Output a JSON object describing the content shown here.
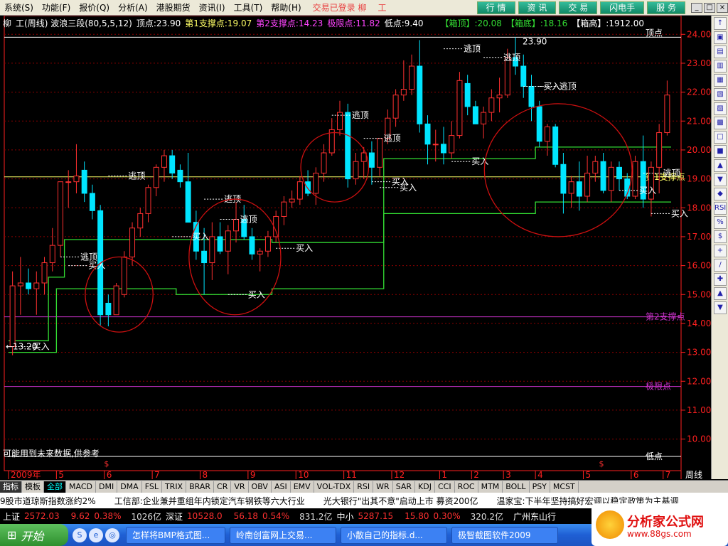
{
  "menu": [
    "系统(S)",
    "功能(F)",
    "报价(Q)",
    "分析(A)",
    "港股期货",
    "资讯(I)",
    "工具(T)",
    "帮助(H)"
  ],
  "status_text": "交易已登录 柳",
  "stock_code": "工",
  "nav_buttons": [
    "行 情",
    "资 讯",
    "交 易",
    "闪电手",
    "服 务"
  ],
  "window_controls": [
    "_",
    "□",
    "×"
  ],
  "info": {
    "prefix": "柳",
    "title": "工(周线) 波浪三段(80,5,5,12)",
    "top_point": "顶点:23.90",
    "support1": "第1支撑点:19.07",
    "support2": "第2支撑点:14.23",
    "limit_point": "极限点:11.82",
    "low_point": "低点:9.40",
    "box_top": "【箱顶】:20.08",
    "box_bottom": "【箱底】:18.16",
    "box_height": "【箱高】:1912.00"
  },
  "chart_data": {
    "type": "candlestick",
    "ylim": [
      9.4,
      24.4
    ],
    "y_ticks": [
      10,
      11,
      12,
      13,
      14,
      15,
      16,
      17,
      18,
      19,
      20,
      21,
      22,
      23,
      24
    ],
    "y_tick_labels": [
      "10.00",
      "11.00",
      "12.00",
      "13.00",
      "14.00",
      "15.00",
      "16.00",
      "17.00",
      "18.00",
      "19.00",
      "20.00",
      "21.00",
      "22.00",
      "23.00",
      "24.00"
    ],
    "x_labels": [
      "2009年",
      "5",
      "6",
      "7",
      "8",
      "9",
      "10",
      "11",
      "12",
      "1",
      "2",
      "3",
      "4",
      "5",
      "6",
      "7",
      "周线"
    ],
    "candles": [
      {
        "o": 13.2,
        "h": 15.8,
        "l": 12.9,
        "c": 15.3
      },
      {
        "o": 15.3,
        "h": 16.3,
        "l": 14.3,
        "c": 15.4
      },
      {
        "o": 15.4,
        "h": 15.9,
        "l": 15.0,
        "c": 15.2
      },
      {
        "o": 15.2,
        "h": 15.8,
        "l": 14.3,
        "c": 15.4
      },
      {
        "o": 15.4,
        "h": 16.3,
        "l": 15.0,
        "c": 16.1
      },
      {
        "o": 16.1,
        "h": 17.3,
        "l": 15.8,
        "c": 16.7
      },
      {
        "o": 16.7,
        "h": 18.0,
        "l": 16.3,
        "c": 18.9
      },
      {
        "o": 18.9,
        "h": 19.3,
        "l": 18.0,
        "c": 18.9
      },
      {
        "o": 18.9,
        "h": 20.2,
        "l": 18.5,
        "c": 19.1
      },
      {
        "o": 19.3,
        "h": 19.6,
        "l": 18.2,
        "c": 18.5
      },
      {
        "o": 18.5,
        "h": 18.8,
        "l": 17.6,
        "c": 17.9
      },
      {
        "o": 17.9,
        "h": 18.1,
        "l": 13.9,
        "c": 14.3
      },
      {
        "o": 14.7,
        "h": 15.0,
        "l": 13.9,
        "c": 14.3
      },
      {
        "o": 14.3,
        "h": 15.4,
        "l": 14.3,
        "c": 15.3
      },
      {
        "o": 15.0,
        "h": 16.5,
        "l": 14.9,
        "c": 16.3
      },
      {
        "o": 16.3,
        "h": 17.5,
        "l": 16.0,
        "c": 17.3
      },
      {
        "o": 17.3,
        "h": 18.0,
        "l": 17.0,
        "c": 17.8
      },
      {
        "o": 17.8,
        "h": 18.8,
        "l": 17.5,
        "c": 18.7
      },
      {
        "o": 18.7,
        "h": 19.5,
        "l": 18.4,
        "c": 19.4
      },
      {
        "o": 19.4,
        "h": 20.0,
        "l": 18.9,
        "c": 19.8
      },
      {
        "o": 19.8,
        "h": 20.0,
        "l": 19.0,
        "c": 19.2
      },
      {
        "o": 19.3,
        "h": 19.5,
        "l": 18.7,
        "c": 18.9
      },
      {
        "o": 18.9,
        "h": 19.9,
        "l": 17.5,
        "c": 17.5
      },
      {
        "o": 17.5,
        "h": 17.9,
        "l": 16.2,
        "c": 16.5
      },
      {
        "o": 16.5,
        "h": 17.3,
        "l": 15.0,
        "c": 16.1
      },
      {
        "o": 16.1,
        "h": 17.5,
        "l": 15.5,
        "c": 17.0
      },
      {
        "o": 17.0,
        "h": 17.5,
        "l": 16.4,
        "c": 16.5
      },
      {
        "o": 16.5,
        "h": 17.4,
        "l": 15.7,
        "c": 17.2
      },
      {
        "o": 17.2,
        "h": 18.2,
        "l": 16.8,
        "c": 17.6
      },
      {
        "o": 17.6,
        "h": 18.1,
        "l": 16.9,
        "c": 17.0
      },
      {
        "o": 17.0,
        "h": 17.3,
        "l": 16.2,
        "c": 16.4
      },
      {
        "o": 16.4,
        "h": 16.6,
        "l": 15.8,
        "c": 16.5
      },
      {
        "o": 16.5,
        "h": 17.2,
        "l": 16.3,
        "c": 17.0
      },
      {
        "o": 17.0,
        "h": 17.9,
        "l": 16.8,
        "c": 17.7
      },
      {
        "o": 17.7,
        "h": 18.4,
        "l": 17.4,
        "c": 18.2
      },
      {
        "o": 18.2,
        "h": 18.6,
        "l": 18.0,
        "c": 18.3
      },
      {
        "o": 18.3,
        "h": 19.1,
        "l": 18.1,
        "c": 18.9
      },
      {
        "o": 18.9,
        "h": 19.3,
        "l": 18.4,
        "c": 18.5
      },
      {
        "o": 18.5,
        "h": 19.4,
        "l": 18.1,
        "c": 19.2
      },
      {
        "o": 19.2,
        "h": 20.2,
        "l": 18.9,
        "c": 19.9
      },
      {
        "o": 19.9,
        "h": 21.1,
        "l": 19.8,
        "c": 20.7
      },
      {
        "o": 20.7,
        "h": 21.7,
        "l": 20.5,
        "c": 21.3
      },
      {
        "o": 21.3,
        "h": 21.6,
        "l": 18.7,
        "c": 19.0
      },
      {
        "o": 19.0,
        "h": 19.9,
        "l": 18.8,
        "c": 19.6
      },
      {
        "o": 19.6,
        "h": 20.1,
        "l": 19.0,
        "c": 19.9
      },
      {
        "o": 19.9,
        "h": 20.3,
        "l": 18.8,
        "c": 19.4
      },
      {
        "o": 19.4,
        "h": 20.4,
        "l": 19.1,
        "c": 20.4
      },
      {
        "o": 20.4,
        "h": 21.4,
        "l": 20.2,
        "c": 21.1
      },
      {
        "o": 21.1,
        "h": 22.1,
        "l": 20.8,
        "c": 21.9
      },
      {
        "o": 21.9,
        "h": 23.1,
        "l": 21.7,
        "c": 22.1
      },
      {
        "o": 22.1,
        "h": 23.3,
        "l": 21.9,
        "c": 22.9
      },
      {
        "o": 22.9,
        "h": 23.8,
        "l": 20.6,
        "c": 20.9
      },
      {
        "o": 20.9,
        "h": 21.2,
        "l": 19.5,
        "c": 20.2
      },
      {
        "o": 20.2,
        "h": 20.7,
        "l": 19.6,
        "c": 20.2
      },
      {
        "o": 20.2,
        "h": 20.8,
        "l": 19.5,
        "c": 19.9
      },
      {
        "o": 19.9,
        "h": 21.0,
        "l": 19.7,
        "c": 20.5
      },
      {
        "o": 20.5,
        "h": 22.7,
        "l": 20.4,
        "c": 22.4
      },
      {
        "o": 22.3,
        "h": 22.6,
        "l": 21.2,
        "c": 21.5
      },
      {
        "o": 21.5,
        "h": 21.7,
        "l": 20.9,
        "c": 20.9
      },
      {
        "o": 20.9,
        "h": 21.5,
        "l": 20.4,
        "c": 21.3
      },
      {
        "o": 21.3,
        "h": 22.1,
        "l": 21.0,
        "c": 21.8
      },
      {
        "o": 21.8,
        "h": 22.5,
        "l": 21.3,
        "c": 21.9
      },
      {
        "o": 21.9,
        "h": 23.5,
        "l": 21.8,
        "c": 23.2
      },
      {
        "o": 23.2,
        "h": 23.9,
        "l": 22.6,
        "c": 22.9
      },
      {
        "o": 22.9,
        "h": 23.3,
        "l": 21.8,
        "c": 22.2
      },
      {
        "o": 22.2,
        "h": 22.6,
        "l": 21.0,
        "c": 21.5
      },
      {
        "o": 21.5,
        "h": 21.7,
        "l": 20.1,
        "c": 20.3
      },
      {
        "o": 20.3,
        "h": 20.9,
        "l": 19.8,
        "c": 20.8
      },
      {
        "o": 20.8,
        "h": 20.9,
        "l": 19.4,
        "c": 19.5
      },
      {
        "o": 19.5,
        "h": 19.9,
        "l": 17.8,
        "c": 18.5
      },
      {
        "o": 18.5,
        "h": 19.1,
        "l": 18.0,
        "c": 18.9
      },
      {
        "o": 18.9,
        "h": 19.6,
        "l": 17.9,
        "c": 18.4
      },
      {
        "o": 18.4,
        "h": 19.8,
        "l": 18.2,
        "c": 19.2
      },
      {
        "o": 19.2,
        "h": 19.8,
        "l": 18.9,
        "c": 19.6
      },
      {
        "o": 19.6,
        "h": 19.9,
        "l": 18.5,
        "c": 18.6
      },
      {
        "o": 18.6,
        "h": 19.6,
        "l": 18.2,
        "c": 19.4
      },
      {
        "o": 19.4,
        "h": 19.6,
        "l": 18.6,
        "c": 19.0
      },
      {
        "o": 19.0,
        "h": 19.2,
        "l": 18.3,
        "c": 18.4
      },
      {
        "o": 18.4,
        "h": 19.8,
        "l": 18.3,
        "c": 19.6
      },
      {
        "o": 19.6,
        "h": 20.5,
        "l": 18.0,
        "c": 18.3
      },
      {
        "o": 18.3,
        "h": 19.6,
        "l": 17.7,
        "c": 19.4
      },
      {
        "o": 19.4,
        "h": 20.9,
        "l": 18.5,
        "c": 20.6
      },
      {
        "o": 20.6,
        "h": 22.4,
        "l": 20.5,
        "c": 21.9
      }
    ],
    "levels": [
      {
        "name": "顶点",
        "value": 23.9,
        "color": "#ffffff"
      },
      {
        "name": "第1支撑点",
        "value": 19.07,
        "color": "#ffff66"
      },
      {
        "name": "第2支撑点",
        "value": 14.23,
        "color": "#cc33cc"
      },
      {
        "name": "极限点",
        "value": 11.82,
        "color": "#cc33cc"
      },
      {
        "name": "低点",
        "value": 9.4,
        "color": "#ffffff"
      }
    ],
    "level_labels": [
      "顶点",
      "第1支撑点",
      "第2支撑点",
      "极限点",
      "低点"
    ],
    "box_lines": {
      "upper": [
        13.4,
        13.4,
        13.4,
        13.4,
        13.4,
        15.6,
        15.6,
        16.9,
        16.9,
        16.9,
        16.9,
        16.9,
        16.9,
        16.9,
        16.9,
        16.9,
        16.9,
        16.9,
        16.9,
        16.9,
        16.9,
        16.9,
        16.9,
        16.9,
        16.9,
        16.9,
        16.9,
        16.9,
        16.9,
        16.9,
        16.9,
        16.9,
        16.9,
        16.8,
        16.8,
        16.8,
        16.8,
        16.8,
        16.8,
        16.8,
        16.8,
        16.8,
        16.8,
        16.8,
        16.8,
        16.8,
        16.8,
        19.7,
        19.7,
        19.7,
        19.7,
        19.7,
        19.7,
        19.7,
        19.7,
        19.7,
        19.7,
        19.7,
        19.7,
        19.7,
        19.7,
        19.7,
        19.7,
        19.7,
        19.7,
        19.7,
        20.1,
        20.1,
        20.1,
        20.1,
        20.1,
        20.1,
        20.1,
        20.1,
        20.1,
        20.1,
        20.1,
        20.1,
        20.1,
        20.1,
        20.1,
        20.1,
        20.1
      ],
      "lower": [
        13.0,
        13.0,
        13.0,
        13.0,
        13.0,
        13.0,
        15.2,
        15.2,
        15.2,
        15.2,
        15.2,
        15.2,
        15.2,
        15.2,
        15.2,
        15.2,
        15.2,
        15.2,
        15.2,
        15.2,
        15.2,
        15.0,
        15.0,
        15.0,
        15.0,
        15.0,
        15.0,
        15.0,
        15.0,
        15.0,
        15.0,
        15.0,
        15.0,
        15.2,
        15.2,
        15.2,
        15.2,
        15.2,
        15.2,
        15.2,
        15.2,
        15.2,
        15.2,
        15.2,
        15.2,
        15.2,
        15.2,
        17.8,
        17.8,
        17.8,
        17.8,
        17.8,
        17.8,
        17.8,
        17.8,
        17.8,
        17.8,
        17.8,
        17.8,
        17.8,
        17.8,
        17.8,
        17.8,
        17.8,
        17.8,
        17.8,
        18.2,
        18.2,
        18.2,
        18.2,
        18.2,
        18.2,
        18.2,
        18.2,
        18.2,
        18.2,
        18.2,
        18.2,
        18.2,
        18.2,
        18.2,
        18.2,
        18.2
      ]
    },
    "signals": [
      {
        "i": 6,
        "text": "逃顶",
        "y": 16.3
      },
      {
        "i": 7,
        "text": "买入",
        "y": 16.0
      },
      {
        "i": 12,
        "text": "逃顶",
        "y": 19.1
      },
      {
        "i": 20,
        "text": "买入",
        "y": 17.0
      },
      {
        "i": 24,
        "text": "逃顶",
        "y": 18.3
      },
      {
        "i": 26,
        "text": "逃顶",
        "y": 17.6
      },
      {
        "i": 27,
        "text": "买入",
        "y": 15.0
      },
      {
        "i": 33,
        "text": "买入",
        "y": 16.6
      },
      {
        "i": 40,
        "text": "逃顶",
        "y": 21.2
      },
      {
        "i": 44,
        "text": "逃顶",
        "y": 20.4
      },
      {
        "i": 45,
        "text": "买入",
        "y": 18.9
      },
      {
        "i": 46,
        "text": "买入",
        "y": 18.7
      },
      {
        "i": 54,
        "text": "逃顶",
        "y": 23.5
      },
      {
        "i": 55,
        "text": "买入",
        "y": 19.6
      },
      {
        "i": 59,
        "text": "逃顶",
        "y": 23.2
      },
      {
        "i": 64,
        "text": "买入",
        "y": 22.2
      },
      {
        "i": 66,
        "text": "逃顶",
        "y": 22.2
      },
      {
        "i": 76,
        "text": "买入",
        "y": 18.6
      },
      {
        "i": 79,
        "text": "逃顶",
        "y": 19.2
      },
      {
        "i": 80,
        "text": "买入",
        "y": 17.8
      },
      {
        "i": 0,
        "text": "买入",
        "y": 13.2
      }
    ],
    "annotations": {
      "left_low": "←13.20",
      "high_value": "23.90",
      "footnote": "可能用到未来数据,供参考"
    }
  },
  "indicator_tabs": [
    "指标",
    "模板",
    "全部",
    "MACD",
    "DMI",
    "DMA",
    "FSL",
    "TRIX",
    "BRAR",
    "CR",
    "VR",
    "OBV",
    "ASI",
    "EMV",
    "VOL-TDX",
    "RSI",
    "WR",
    "SAR",
    "KDJ",
    "CCI",
    "ROC",
    "MTM",
    "BOLL",
    "PSY",
    "MCST"
  ],
  "news": [
    "9股市道琼斯指数涨约2%",
    "工信部:企业兼并重组年内锁定汽车钢铁等六大行业",
    "光大银行\"出其不意\"启动上市  募资200亿",
    "温家宝:下半年坚持搞好宏调以稳定政策为主基调"
  ],
  "ticker": {
    "sh_label": "上证",
    "sh_value": "2572.03",
    "sh_change": "9.62",
    "sh_pct": "0.38%",
    "sh_amount": "1026亿",
    "sz_label": "深证",
    "sz_value": "10528.0",
    "sz_change": "56.18",
    "sz_pct": "0.54%",
    "sz_amount": "831.2亿",
    "zx_label": "中小",
    "zx_value": "5287.15",
    "zx_change": "15.80",
    "zx_pct": "0.30%",
    "zx_amount": "320.2亿",
    "location": "广州东山行"
  },
  "taskbar": {
    "start": "开始",
    "tasks": [
      "怎样将BMP格式图...",
      "岭南创富网上交易...",
      "小散自己的指标.d...",
      "极智截图软件2009"
    ]
  },
  "watermark": {
    "title": "分析家公式网",
    "url": "www.88gs.com"
  },
  "right_tools": [
    "↑",
    "▣",
    "▤",
    "▥",
    "▦",
    "▧",
    "▨",
    "▩",
    "□",
    "■",
    "▲",
    "▼",
    "◆",
    "RSI",
    "%",
    "$",
    "+",
    "/",
    "✚",
    "▲",
    "▼"
  ],
  "colors": {
    "up": "#ff3030",
    "down": "#00e5ff",
    "grid": "#8b0000",
    "axis": "#ff2020",
    "box": "#33dd33",
    "circle": "#cc1010",
    "signal": "#ffffff"
  }
}
